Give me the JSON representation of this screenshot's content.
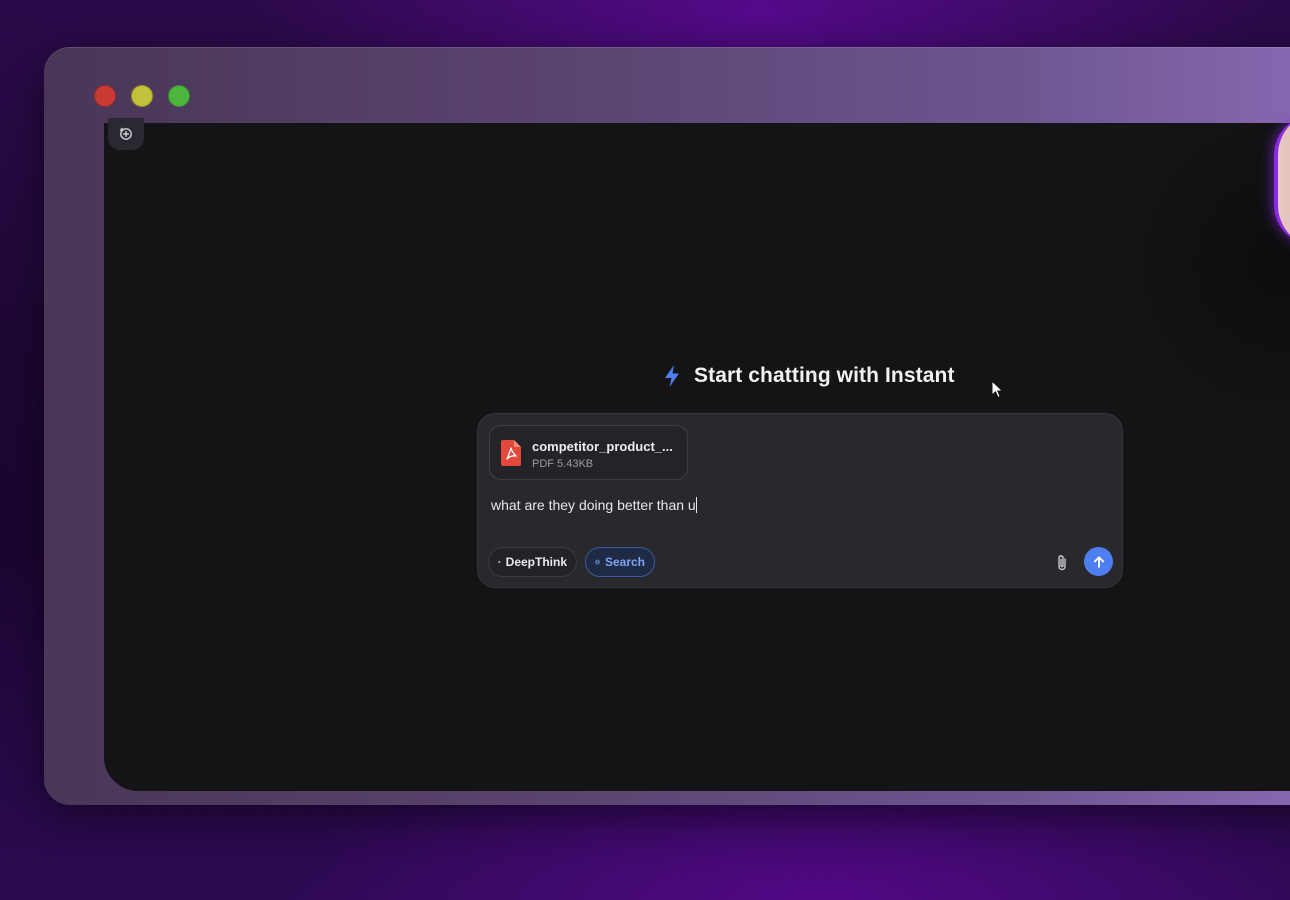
{
  "window": {
    "controls": [
      "close",
      "minimize",
      "maximize"
    ]
  },
  "sidebar": {
    "new_chat_icon": "new-chat-icon"
  },
  "hero": {
    "icon": "lightning-bolt-icon",
    "title": "Start chatting with Instant",
    "accent_color": "#4f7ef0"
  },
  "composer": {
    "attachment": {
      "icon": "pdf-icon",
      "file_name": "competitor_product_...",
      "file_meta": "PDF 5.43KB"
    },
    "input_value": "what are they doing better than u",
    "buttons": {
      "deepthink_label": "DeepThink",
      "search_label": "Search",
      "attach_icon": "paperclip-icon",
      "send_icon": "arrow-up-icon"
    }
  }
}
